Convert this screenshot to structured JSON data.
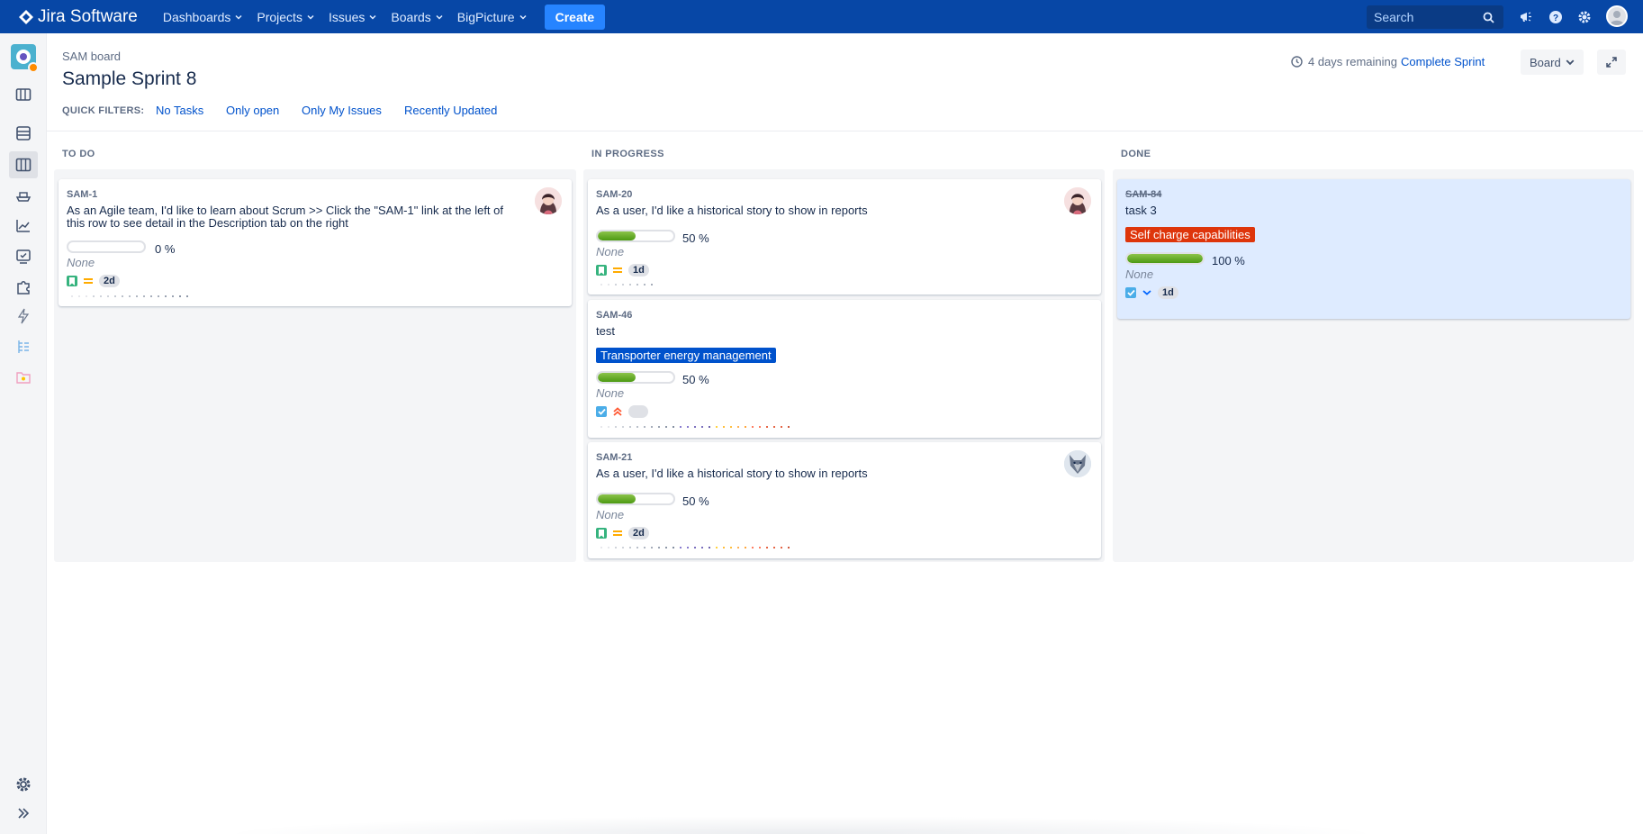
{
  "app": {
    "name": "Jira Software"
  },
  "nav": {
    "items": [
      {
        "label": "Dashboards"
      },
      {
        "label": "Projects"
      },
      {
        "label": "Issues"
      },
      {
        "label": "Boards"
      },
      {
        "label": "BigPicture"
      }
    ],
    "create_label": "Create",
    "search_placeholder": "Search"
  },
  "header": {
    "breadcrumb": "SAM board",
    "title": "Sample Sprint 8",
    "quick_filters_label": "QUICK FILTERS:",
    "quick_filters": [
      "No Tasks",
      "Only open",
      "Only My Issues",
      "Recently Updated"
    ],
    "remaining": "4 days remaining",
    "complete_sprint": "Complete Sprint",
    "board_button": "Board"
  },
  "columns": [
    {
      "title": "TO DO"
    },
    {
      "title": "IN PROGRESS"
    },
    {
      "title": "DONE"
    }
  ],
  "cards": {
    "sam1": {
      "key": "SAM-1",
      "summary_line1": "As an Agile team, I'd like to learn about Scrum >> Click the \"SAM-1\" link at the left of",
      "summary_line2": "this row to see detail in the Description tab on the right",
      "progress": 0,
      "pct": "0 %",
      "fix": "None",
      "estimate": "2d"
    },
    "sam20": {
      "key": "SAM-20",
      "summary": "As a user, I'd like a historical story to show in reports",
      "progress": 50,
      "pct": "50 %",
      "fix": "None",
      "estimate": "1d"
    },
    "sam46": {
      "key": "SAM-46",
      "summary": "test",
      "epic": "Transporter energy management",
      "epic_color": "#0052cc",
      "progress": 50,
      "pct": "50 %",
      "fix": "None"
    },
    "sam21": {
      "key": "SAM-21",
      "summary": "As a user, I'd like a historical story to show in reports",
      "progress": 50,
      "pct": "50 %",
      "fix": "None",
      "estimate": "2d"
    },
    "sam84": {
      "key": "SAM-84",
      "summary": "task 3",
      "epic": "Self charge capabilities",
      "epic_color": "#de350b",
      "progress": 100,
      "pct": "100 %",
      "fix": "None",
      "estimate": "1d"
    }
  },
  "colors": {
    "nav": "#0747a6",
    "link": "#0052cc",
    "done_card": "#deebff",
    "progress": "#4c9a13"
  }
}
